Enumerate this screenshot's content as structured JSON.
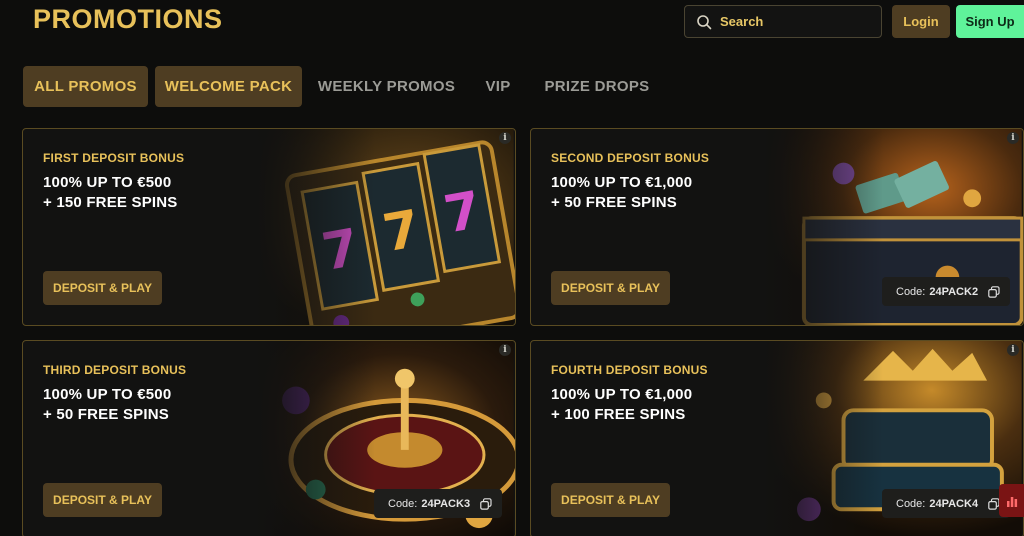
{
  "header": {
    "title": "PROMOTIONS",
    "search_placeholder": "Search",
    "login_label": "Login",
    "signup_label": "Sign Up",
    "accent_color": "#e8c15a",
    "signup_color": "#5ff39a"
  },
  "tabs": [
    {
      "label": "ALL PROMOS",
      "active": true
    },
    {
      "label": "WELCOME PACK",
      "active": true
    },
    {
      "label": "WEEKLY PROMOS",
      "active": false
    },
    {
      "label": "VIP",
      "active": false
    },
    {
      "label": "PRIZE DROPS",
      "active": false
    }
  ],
  "cards": [
    {
      "label": "FIRST DEPOSIT BONUS",
      "line1": "100% UP TO €500",
      "line2": "+ 150 FREE SPINS",
      "button": "DEPOSIT & PLAY",
      "art": "slot-machine-777"
    },
    {
      "label": "SECOND DEPOSIT BONUS",
      "line1": "100% UP TO €1,000",
      "line2": "+ 50 FREE SPINS",
      "button": "DEPOSIT & PLAY",
      "code_prefix": "Code:",
      "code": "24PACK2",
      "art": "treasure-chest"
    },
    {
      "label": "THIRD DEPOSIT BONUS",
      "line1": "100% UP TO €500",
      "line2": "+ 50 FREE SPINS",
      "button": "DEPOSIT & PLAY",
      "code_prefix": "Code:",
      "code": "24PACK3",
      "art": "roulette-wheel"
    },
    {
      "label": "FOURTH DEPOSIT BONUS",
      "line1": "100% UP TO €1,000",
      "line2": "+ 100 FREE SPINS",
      "button": "DEPOSIT & PLAY",
      "code_prefix": "Code:",
      "code": "24PACK4",
      "art": "golden-throne"
    }
  ],
  "info_glyph": "i"
}
